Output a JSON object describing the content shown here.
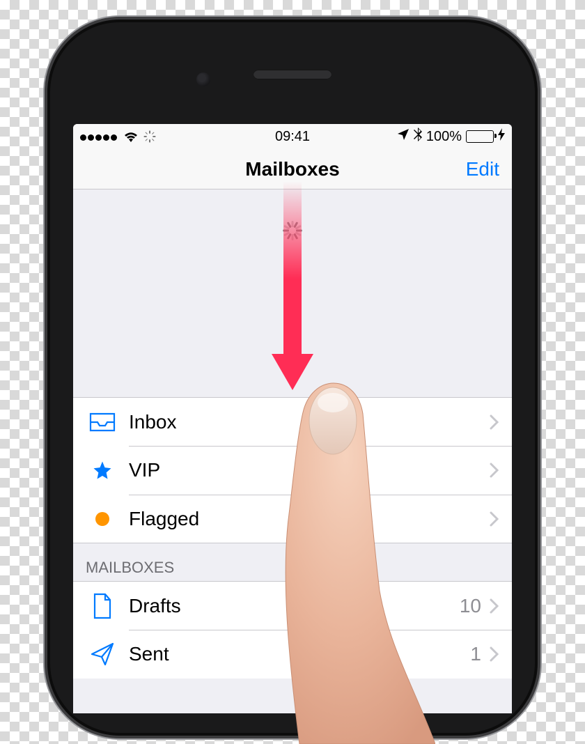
{
  "status_bar": {
    "time": "09:41",
    "battery_percent": "100%"
  },
  "nav": {
    "title": "Mailboxes",
    "edit": "Edit"
  },
  "primary": [
    {
      "icon": "inbox-icon",
      "label": "Inbox"
    },
    {
      "icon": "star-icon",
      "label": "VIP"
    },
    {
      "icon": "flag-dot-icon",
      "label": "Flagged"
    }
  ],
  "section": {
    "header": "MAILBOXES",
    "items": [
      {
        "icon": "drafts-icon",
        "label": "Drafts",
        "count": "10"
      },
      {
        "icon": "sent-icon",
        "label": "Sent",
        "count": "1"
      }
    ]
  }
}
